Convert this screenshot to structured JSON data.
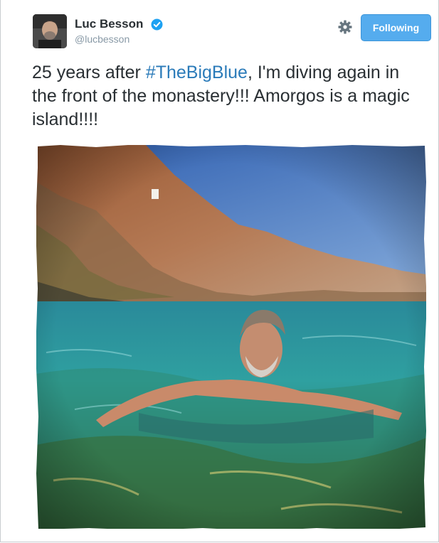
{
  "user": {
    "display_name": "Luc Besson",
    "handle": "@lucbesson",
    "verified": true
  },
  "actions": {
    "settings_icon": "gear-icon",
    "follow_label": "Following"
  },
  "tweet": {
    "text_before": "25 years after ",
    "hashtag": "#TheBigBlue",
    "text_after": ", I'm diving again in the front of the monastery!!! Amorgos is a magic island!!!!"
  },
  "colors": {
    "follow_button": "#55acee",
    "hashtag": "#2b7bb9",
    "verified_badge": "#1da1f2"
  }
}
